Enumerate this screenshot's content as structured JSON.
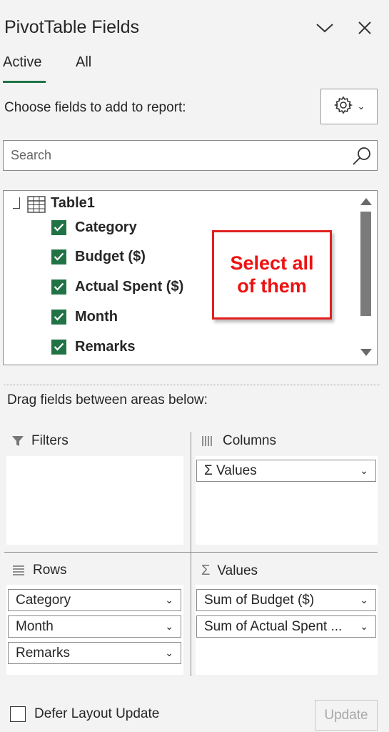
{
  "pane": {
    "title": "PivotTable Fields"
  },
  "tabs": [
    {
      "label": "Active",
      "active": true
    },
    {
      "label": "All",
      "active": false
    }
  ],
  "choose_label": "Choose fields to add to report:",
  "search": {
    "placeholder": "Search"
  },
  "table": {
    "name": "Table1"
  },
  "fields": [
    {
      "label": "Category",
      "checked": true
    },
    {
      "label": "Budget ($)",
      "checked": true
    },
    {
      "label": "Actual Spent ($)",
      "checked": true
    },
    {
      "label": "Month",
      "checked": true
    },
    {
      "label": "Remarks",
      "checked": true
    }
  ],
  "annotation": {
    "text": "Select all\nof them",
    "color": "#ee1111"
  },
  "drag_label": "Drag fields between areas below:",
  "areas": {
    "filters": {
      "title": "Filters",
      "items": []
    },
    "columns": {
      "title": "Columns",
      "items": [
        "Σ Values"
      ]
    },
    "rows": {
      "title": "Rows",
      "items": [
        "Category",
        "Month",
        "Remarks"
      ]
    },
    "values": {
      "title": "Values",
      "items": [
        "Sum of Budget ($)",
        "Sum of Actual Spent ..."
      ]
    }
  },
  "footer": {
    "defer_label": "Defer Layout Update",
    "update_label": "Update"
  },
  "colors": {
    "accent": "#217346",
    "callout": "#e02020"
  }
}
